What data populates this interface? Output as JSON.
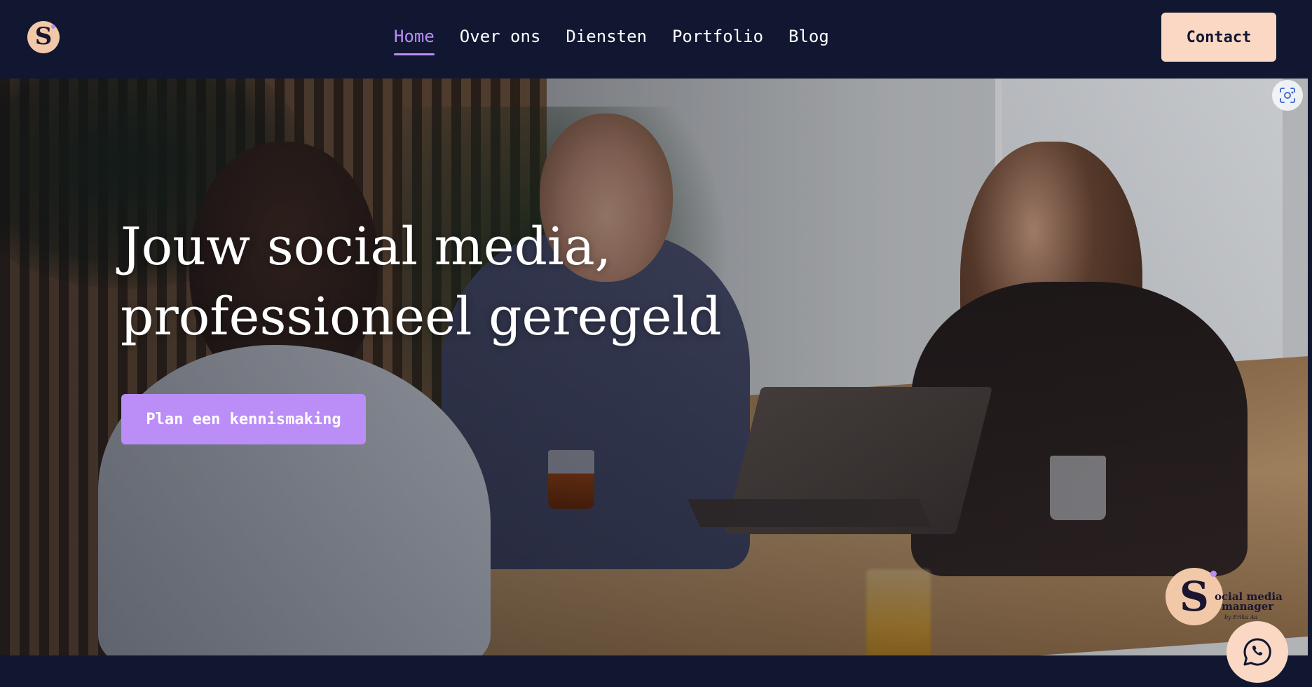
{
  "header": {
    "logo_letter": "S",
    "nav": [
      {
        "label": "Home",
        "active": true
      },
      {
        "label": "Over ons",
        "active": false
      },
      {
        "label": "Diensten",
        "active": false
      },
      {
        "label": "Portfolio",
        "active": false
      },
      {
        "label": "Blog",
        "active": false
      }
    ],
    "contact_label": "Contact"
  },
  "hero": {
    "title_line1": "Jouw social media,",
    "title_line2": "professioneel geregeld",
    "cta_label": "Plan een kennismaking",
    "image_search_icon": "lens-icon"
  },
  "floating": {
    "badge_letter": "S",
    "badge_text_line1": "ocial media",
    "badge_text_line2": "manager",
    "badge_sub": "by Erika Aa",
    "whatsapp_icon": "whatsapp-icon"
  },
  "colors": {
    "background": "#111731",
    "accent": "#bb8df7",
    "peach": "#fad8c4",
    "logo_bg": "#f2c9a8"
  }
}
